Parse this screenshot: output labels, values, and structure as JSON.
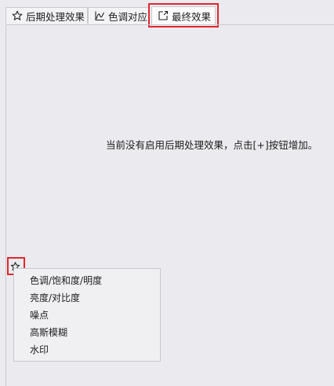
{
  "tabs": [
    {
      "label": "后期处理效果",
      "icon": "star-outline-icon"
    },
    {
      "label": "色调对应",
      "icon": "curve-chart-icon"
    },
    {
      "label": "最终效果",
      "icon": "export-icon",
      "active": true
    }
  ],
  "main": {
    "empty_message": "当前没有启用后期处理效果，点击[+]按钮增加。"
  },
  "add_button": {
    "icon": "star-add-icon"
  },
  "effects_menu": {
    "items": [
      "色调/饱和度/明度",
      "亮度/对比度",
      "噪点",
      "高斯模糊",
      "水印"
    ]
  },
  "colors": {
    "highlight": "#e0262f",
    "background": "#ebebef",
    "border": "#c9c9cf"
  }
}
